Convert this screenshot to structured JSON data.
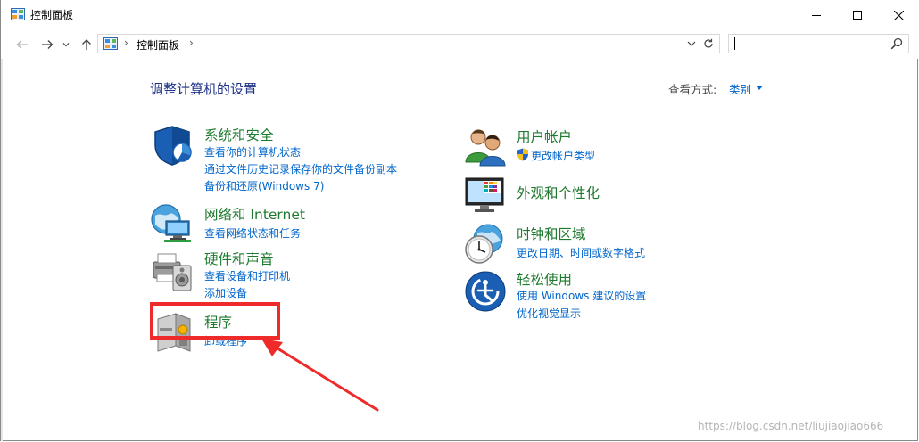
{
  "window": {
    "title": "控制面板",
    "controls": {
      "minimize": "minimize",
      "maximize": "maximize",
      "close": "close"
    }
  },
  "address_bar": {
    "separator": "›",
    "path": "控制面板",
    "trailing_separator": "›"
  },
  "search": {
    "value": "",
    "placeholder": ""
  },
  "header": {
    "title": "调整计算机的设置",
    "view_by_label": "查看方式:",
    "view_by_value": "类别"
  },
  "categories_left": [
    {
      "title": "系统和安全",
      "icon": "shield-icon",
      "links": [
        "查看你的计算机状态",
        "通过文件历史记录保存你的文件备份副本",
        "备份和还原(Windows 7)"
      ]
    },
    {
      "title": "网络和 Internet",
      "icon": "network-globe-icon",
      "links": [
        "查看网络状态和任务"
      ]
    },
    {
      "title": "硬件和声音",
      "icon": "printer-speaker-icon",
      "links": [
        "查看设备和打印机",
        "添加设备"
      ]
    },
    {
      "title": "程序",
      "icon": "programs-icon",
      "links": [
        "卸载程序"
      ]
    }
  ],
  "categories_right": [
    {
      "title": "用户帐户",
      "icon": "users-icon",
      "links": [
        "更改帐户类型"
      ]
    },
    {
      "title": "外观和个性化",
      "icon": "monitor-palette-icon",
      "links": []
    },
    {
      "title": "时钟和区域",
      "icon": "clock-globe-icon",
      "links": [
        "更改日期、时间或数字格式"
      ]
    },
    {
      "title": "轻松使用",
      "icon": "ease-of-access-icon",
      "links": [
        "使用 Windows 建议的设置",
        "优化视觉显示"
      ]
    }
  ],
  "annotation": {
    "color": "#ee2a2a"
  },
  "watermark": "https://blog.csdn.net/liujiaojiao666",
  "colors": {
    "title_blue": "#1e3287",
    "category_green": "#1e7a2e",
    "link_blue": "#0066cc"
  }
}
